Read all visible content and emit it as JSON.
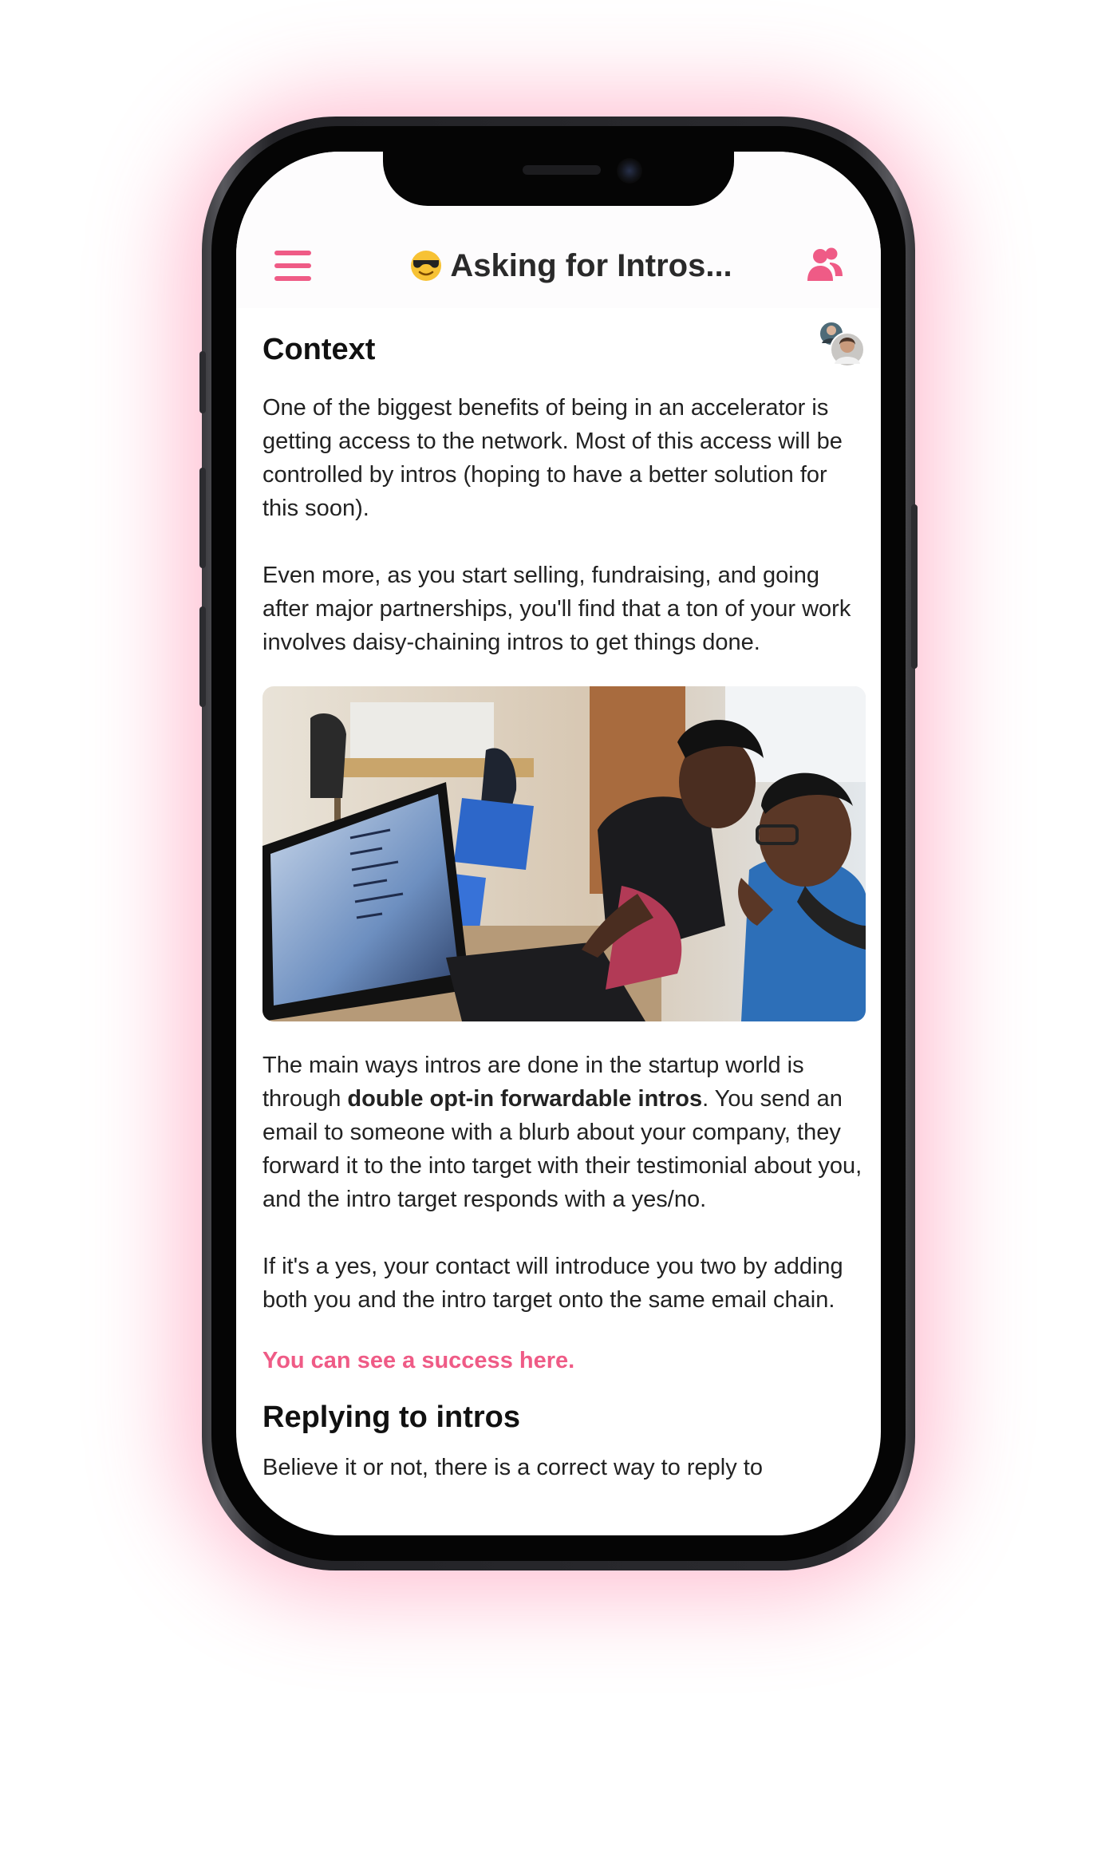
{
  "header": {
    "title": "Asking for Intros...",
    "emoji": "sunglasses-emoji",
    "accent_color": "#ef5b86"
  },
  "article": {
    "heading_context": "Context",
    "paragraph_1": "One of the biggest benefits of being in an accelerator is getting access to the network. Most of this access will be controlled by intros (hoping to have a better solution for this soon).",
    "paragraph_2": "Even more, as you start selling, fundraising, and going after major partnerships, you'll find that a ton of your work involves daisy-chaining intros to get things done.",
    "paragraph_3_before": "The main ways intros are done in the startup world is through ",
    "paragraph_3_bold": "double opt-in forwardable intros",
    "paragraph_3_after": ". You send an email to someone with a blurb about your company, they forward it to the into target with their testimonial about you, and the intro target responds with a yes/no.",
    "paragraph_4": "If it's a yes, your contact will introduce you two by adding both you and the intro target onto the same email chain.",
    "success_link": "You can see a success here.",
    "heading_replying": "Replying to intros",
    "paragraph_5_partial": "Believe it or not, there is a correct way to reply to"
  }
}
